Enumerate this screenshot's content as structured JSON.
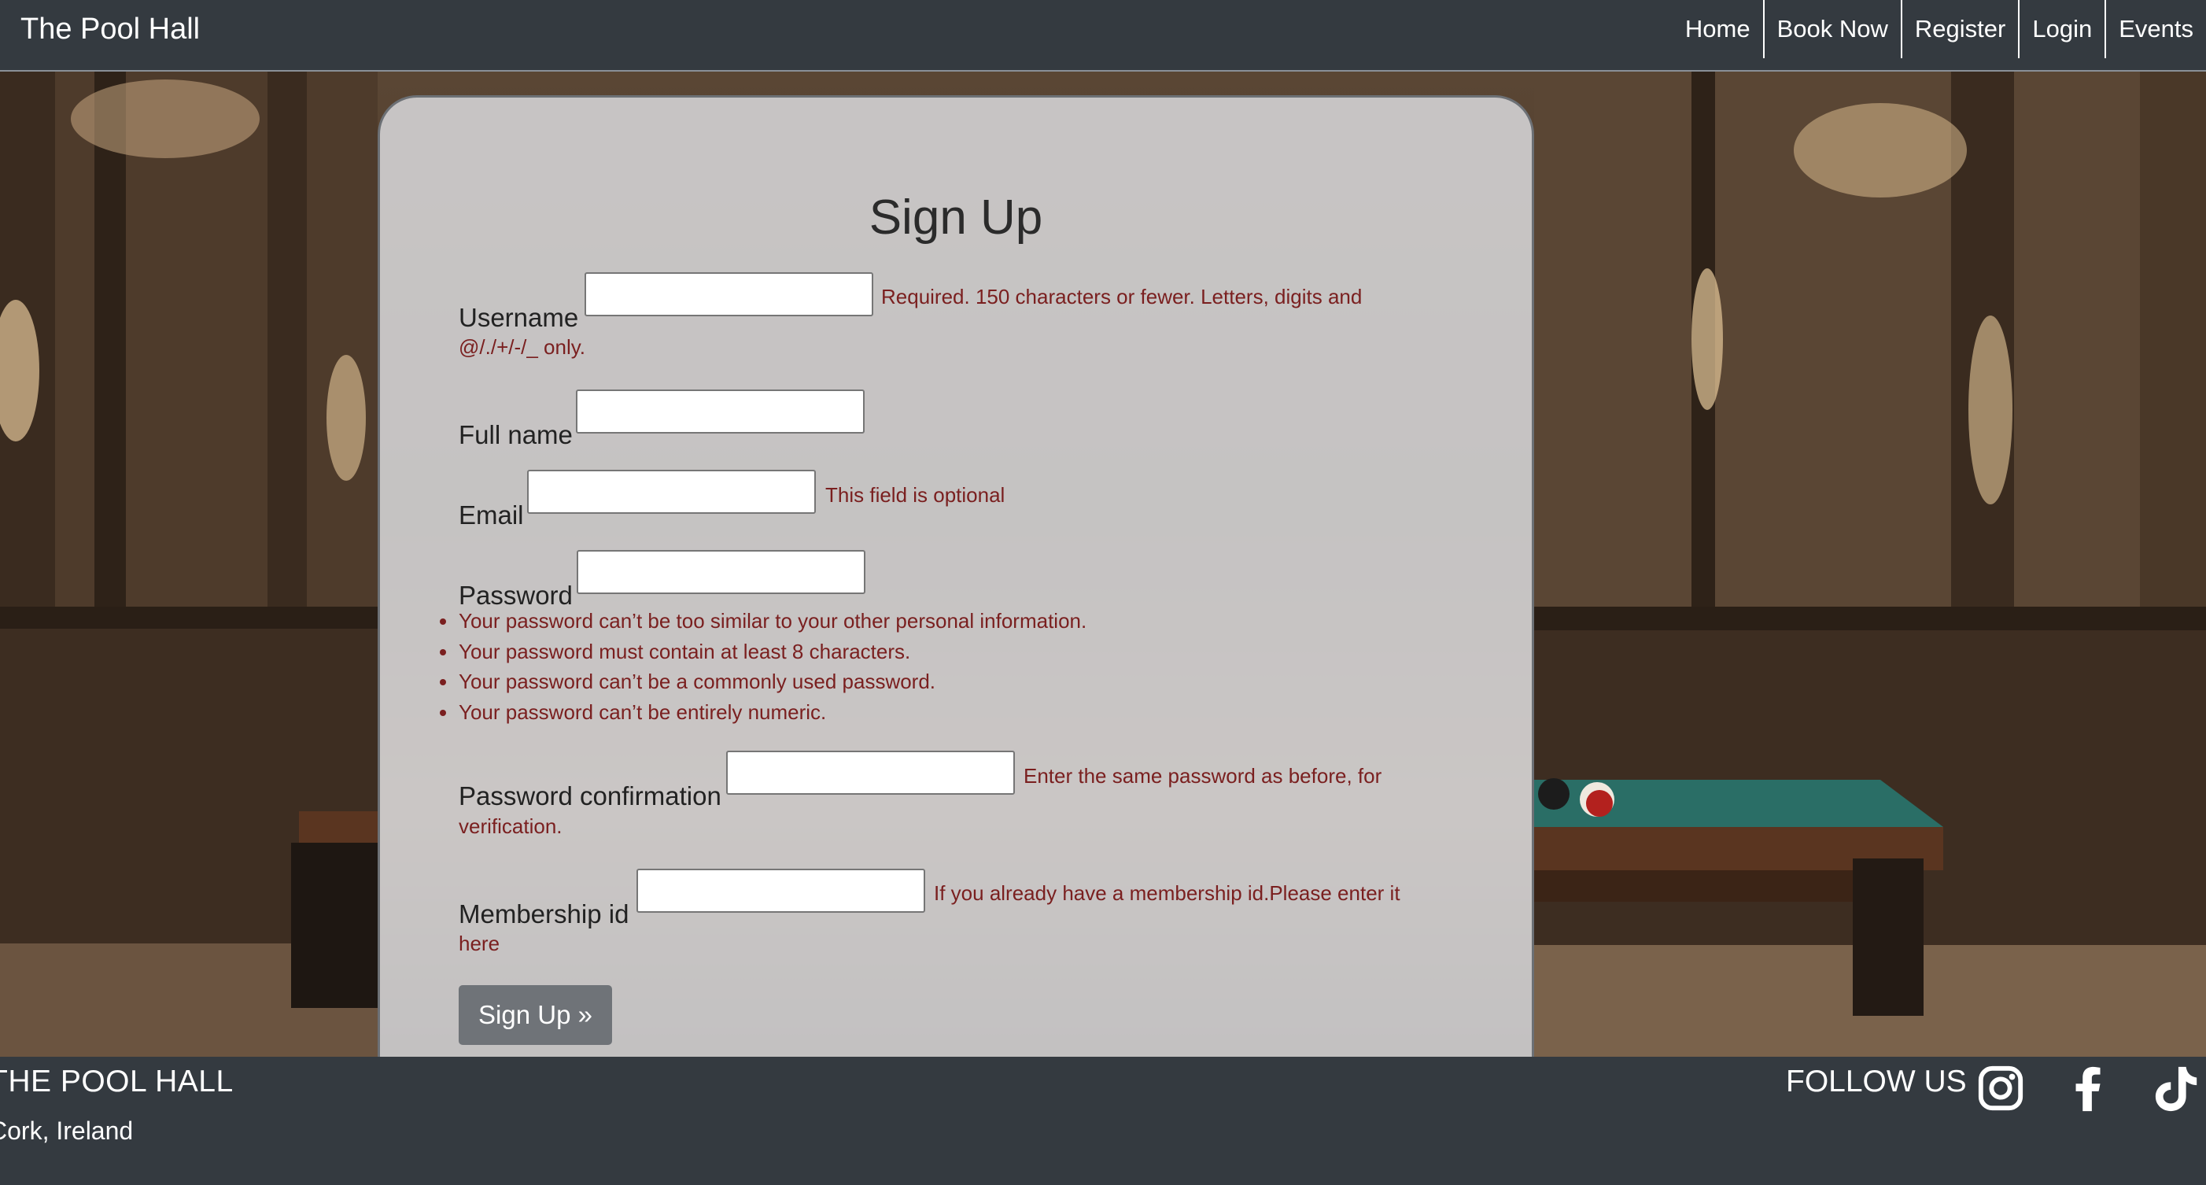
{
  "navbar": {
    "brand": "The Pool Hall",
    "links": [
      "Home",
      "Book Now",
      "Register",
      "Login",
      "Events"
    ]
  },
  "form": {
    "title": "Sign Up",
    "fields": {
      "username": {
        "label": "Username",
        "value": "",
        "help": "Required. 150 characters or fewer. Letters, digits and",
        "help2": "@/./+/-/_ only."
      },
      "full_name": {
        "label": "Full name",
        "value": ""
      },
      "email": {
        "label": "Email",
        "value": "",
        "help": "This field is optional"
      },
      "password": {
        "label": "Password",
        "value": "",
        "rules": [
          "Your password can’t be too similar to your other personal information.",
          "Your password must contain at least 8 characters.",
          "Your password can’t be a commonly used password.",
          "Your password can’t be entirely numeric."
        ]
      },
      "password_confirmation": {
        "label": "Password confirmation",
        "value": "",
        "help": "Enter the same password as before, for",
        "help2": "verification."
      },
      "membership_id": {
        "label": "Membership id",
        "value": "",
        "help": "If you already have a membership id.Please enter it",
        "help2": "here"
      }
    },
    "submit_label": "Sign Up »"
  },
  "footer": {
    "title": "THE POOL HALL",
    "location": "Cork, Ireland",
    "follow": "FOLLOW US",
    "social": [
      "instagram-icon",
      "facebook-icon",
      "tiktok-icon"
    ]
  },
  "colors": {
    "nav_bg": "#343a40",
    "help_text": "#7a1f1f",
    "button": "#6f7378"
  }
}
